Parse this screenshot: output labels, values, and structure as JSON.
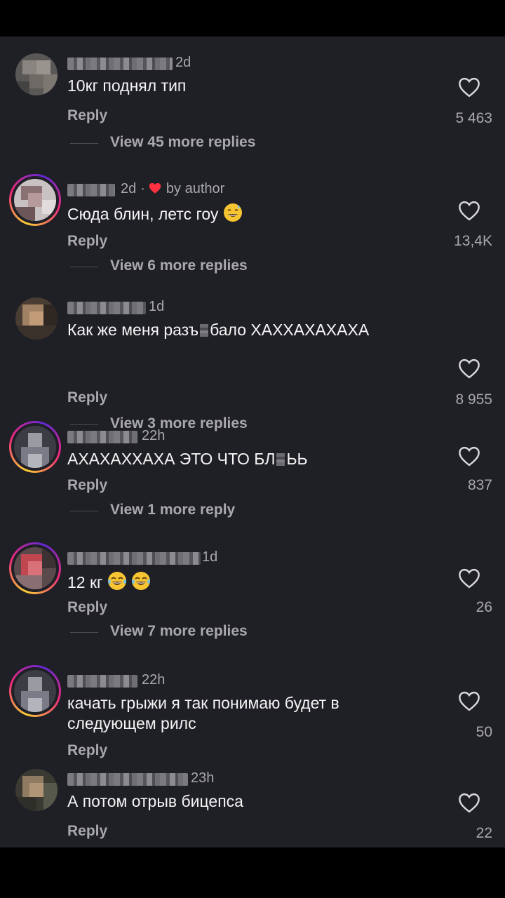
{
  "comments": [
    {
      "time": "2d",
      "by_author": "",
      "text": "10кг поднял тип",
      "reply": "Reply",
      "likes": "5 463",
      "view_more": "View 45 more replies"
    },
    {
      "time": "2d",
      "by_author": "by author",
      "text": "Сюда блин, летс гоу",
      "reply": "Reply",
      "likes": "13,4K",
      "view_more": "View 6 more replies"
    },
    {
      "time": "1d",
      "text_a": "Как же меня разъ",
      "text_b": "бало ХАХХАХАХАХА",
      "reply": "Reply",
      "likes": "8 955",
      "view_more": "View 3 more replies"
    },
    {
      "time": "22h",
      "text_a": "АХАХАХХАХА ЭТО ЧТО БЛ",
      "text_b": "ЬЬ",
      "reply": "Reply",
      "likes": "837",
      "view_more": "View 1 more reply"
    },
    {
      "time": "1d",
      "text": "12 кг",
      "reply": "Reply",
      "likes": "26",
      "view_more": "View 7 more replies"
    },
    {
      "time": "22h",
      "text": "качать грыжи я так понимаю будет в следующем рилс",
      "reply": "Reply",
      "likes": "50"
    },
    {
      "time": "23h",
      "text": "А потом отрыв бицепса",
      "reply": "Reply",
      "likes": "22"
    }
  ],
  "icons": {
    "like": "heart-outline-icon",
    "author_like": "heart-filled-icon",
    "emoji_sweat_smile": "grinning-sweat-emoji",
    "emoji_joy": "tears-of-joy-emoji"
  },
  "colors": {
    "background": "#1f1f26",
    "text": "#f5f5f5",
    "muted": "#a8a8ad",
    "author_heart": "#ff3040"
  }
}
